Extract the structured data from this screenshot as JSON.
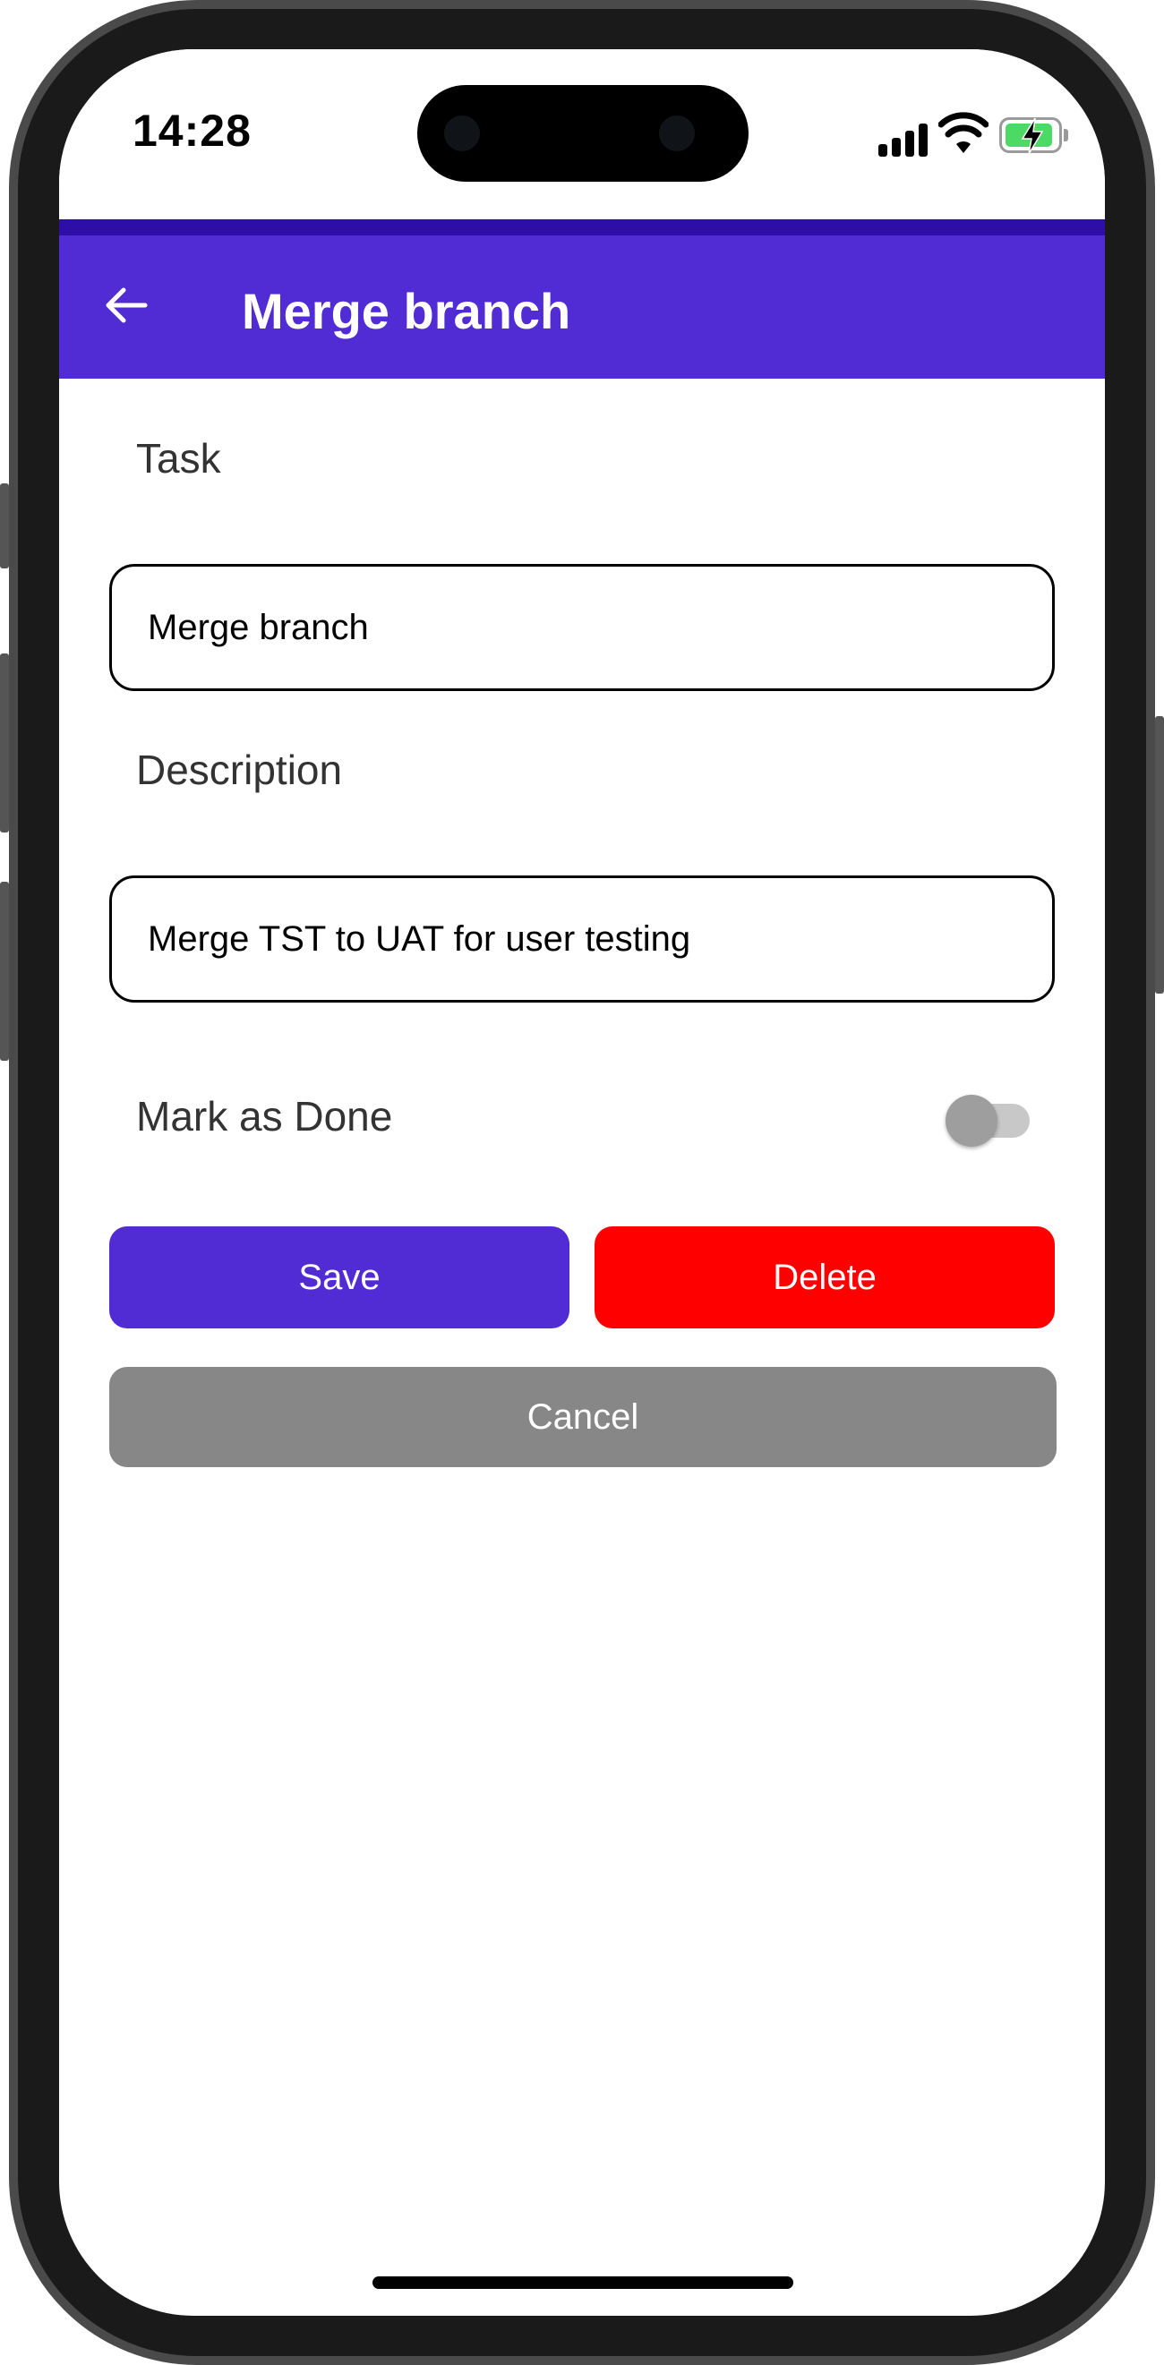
{
  "status_bar": {
    "time": "14:28"
  },
  "appbar": {
    "title": "Merge branch"
  },
  "form": {
    "task_label": "Task",
    "task_value": "Merge branch",
    "description_label": "Description",
    "description_value": "Merge TST to UAT for user testing",
    "done_label": "Mark as Done",
    "done_checked": false
  },
  "buttons": {
    "save": "Save",
    "delete": "Delete",
    "cancel": "Cancel"
  },
  "colors": {
    "primary": "#512bd4",
    "danger": "#ff0000",
    "neutral": "#878787"
  }
}
